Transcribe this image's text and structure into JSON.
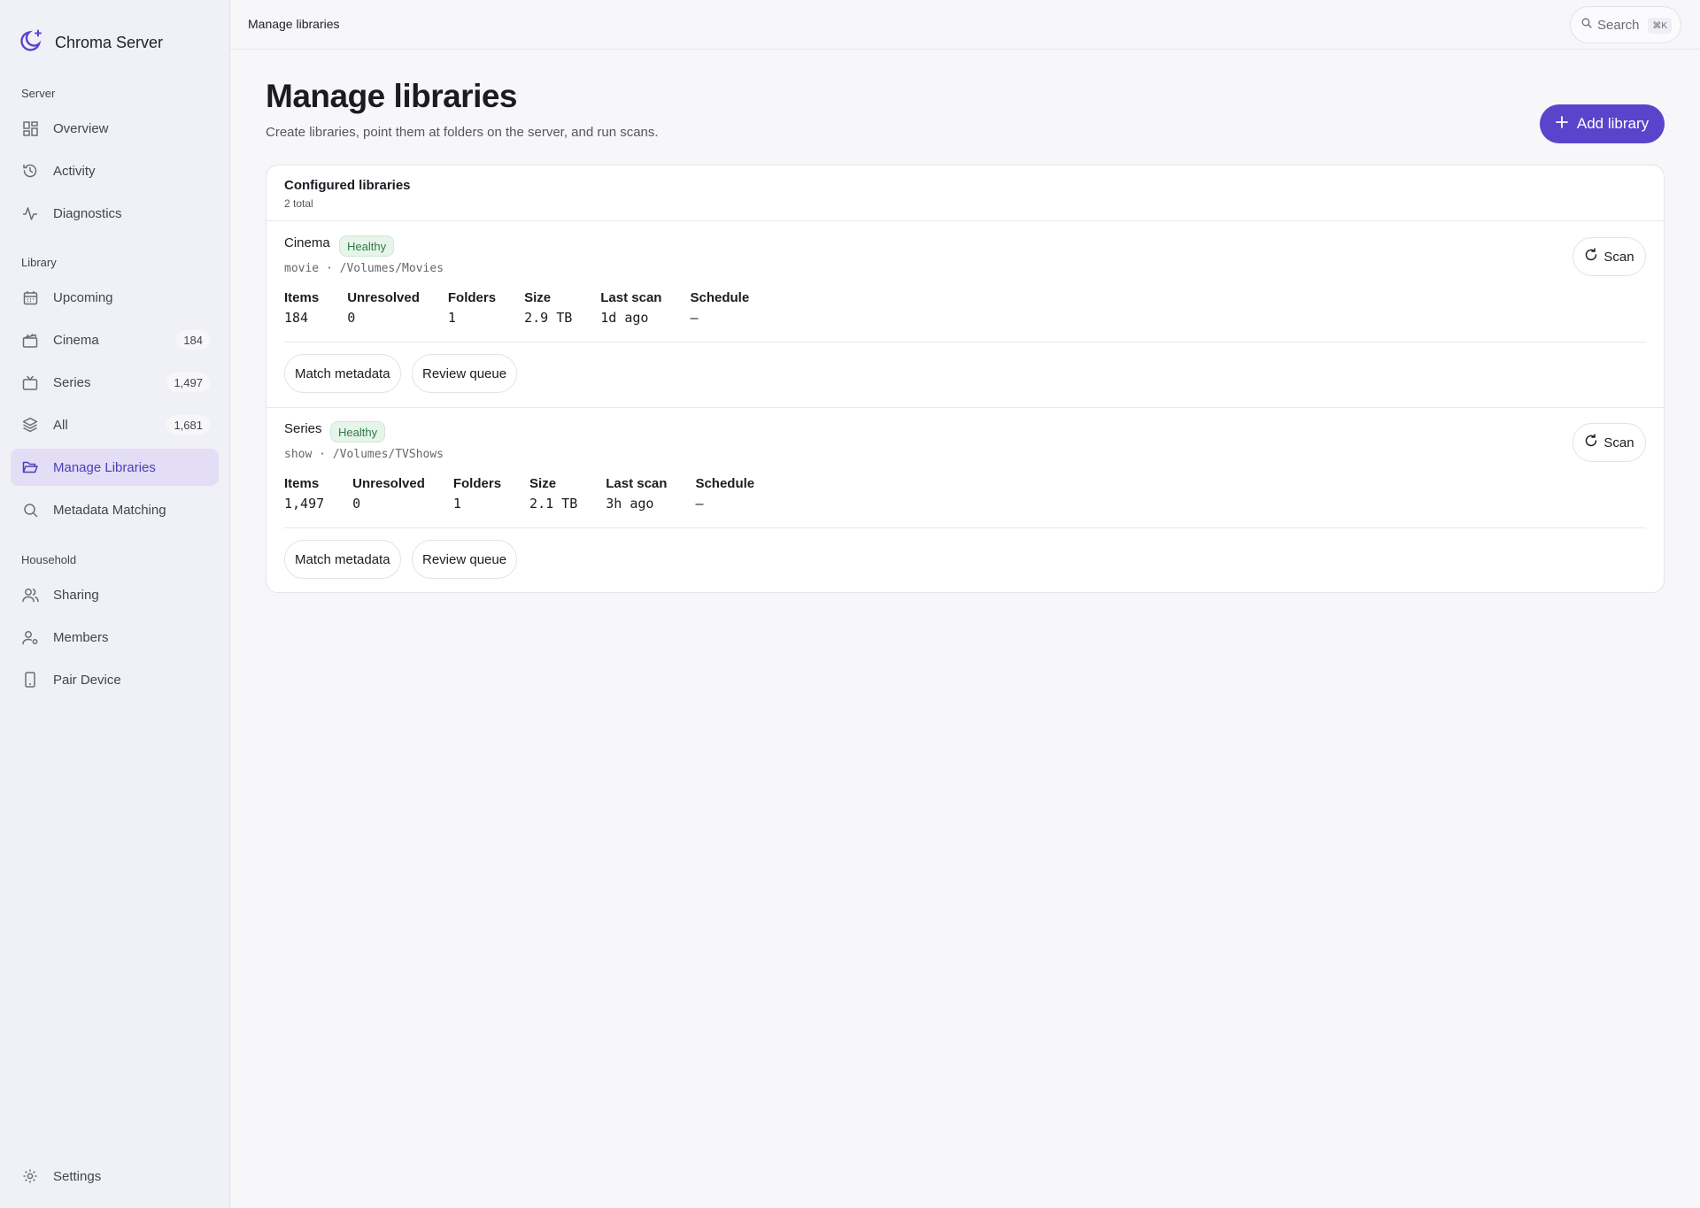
{
  "app": {
    "name": "Chroma Server"
  },
  "sidebar": {
    "sections": [
      {
        "label": "Server"
      },
      {
        "label": "Library"
      },
      {
        "label": "Household"
      }
    ],
    "items": [
      {
        "label": "Overview",
        "icon": "grid-icon"
      },
      {
        "label": "Activity",
        "icon": "history-icon"
      },
      {
        "label": "Diagnostics",
        "icon": "pulse-icon"
      },
      {
        "label": "Upcoming",
        "icon": "calendar-icon"
      },
      {
        "label": "Cinema",
        "icon": "clapperboard-icon",
        "count": "184"
      },
      {
        "label": "Series",
        "icon": "tv-icon",
        "count": "1,497"
      },
      {
        "label": "All",
        "icon": "layers-icon",
        "count": "1,681"
      },
      {
        "label": "Manage Libraries",
        "icon": "folder-icon",
        "active": true
      },
      {
        "label": "Metadata Matching",
        "icon": "search-icon"
      },
      {
        "label": "Sharing",
        "icon": "users-icon"
      },
      {
        "label": "Members",
        "icon": "user-gear-icon"
      },
      {
        "label": "Pair Device",
        "icon": "phone-icon"
      }
    ],
    "settings": {
      "label": "Settings",
      "icon": "gear-icon"
    }
  },
  "topbar": {
    "title": "Manage libraries",
    "search": {
      "label": "Search",
      "shortcut": "⌘K"
    }
  },
  "main": {
    "title": "Manage libraries",
    "subtitle": "Create libraries, point them at folders on the server, and run scans.",
    "add_button": "Add library",
    "card": {
      "title": "Configured libraries",
      "count": "2 total",
      "stat_labels": [
        "Items",
        "Unresolved",
        "Folders",
        "Size",
        "Last scan",
        "Schedule"
      ],
      "libraries": [
        {
          "name": "Cinema",
          "status": "Healthy",
          "path": "movie · /Volumes/Movies",
          "stats": [
            "184",
            "0",
            "1",
            "2.9 TB",
            "1d ago",
            "—"
          ],
          "scan_label": "Scan",
          "match_label": "Match metadata",
          "review_label": "Review queue"
        },
        {
          "name": "Series",
          "status": "Healthy",
          "path": "show · /Volumes/TVShows",
          "stats": [
            "1,497",
            "0",
            "1",
            "2.1 TB",
            "3h ago",
            "—"
          ],
          "scan_label": "Scan",
          "match_label": "Match metadata",
          "review_label": "Review queue"
        }
      ]
    }
  },
  "colors": {
    "accent": "#5a44cc",
    "active_bg": "#e3ddf6",
    "healthy_bg": "#e6f4ea",
    "healthy_text": "#2e7b45"
  }
}
